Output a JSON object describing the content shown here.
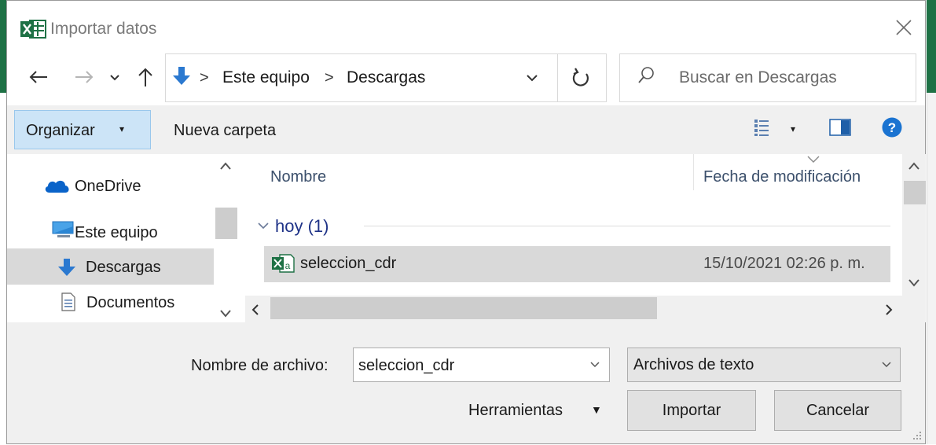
{
  "dialog": {
    "title": "Importar datos",
    "icons": {
      "app": "excel-icon",
      "close": "close-icon"
    }
  },
  "nav": {
    "address": {
      "crumbs": [
        "Este equipo",
        "Descargas"
      ],
      "separator": ">"
    },
    "search_placeholder": "Buscar en Descargas"
  },
  "toolbar": {
    "organize_label": "Organizar",
    "organize_caret": "▾",
    "new_folder_label": "Nueva carpeta",
    "view_caret": "▾"
  },
  "sidebar": {
    "items": [
      {
        "label": "OneDrive",
        "icon": "cloud-icon",
        "selected": false
      },
      {
        "label": "Este equipo",
        "icon": "computer-icon",
        "selected": false
      },
      {
        "label": "Descargas",
        "icon": "download-arrow-icon",
        "selected": true
      },
      {
        "label": "Documentos",
        "icon": "document-icon",
        "selected": false
      }
    ]
  },
  "files": {
    "columns": [
      "Nombre",
      "Fecha de modificación"
    ],
    "groups": [
      {
        "label": "hoy (1)",
        "items": [
          {
            "name": "seleccion_cdr",
            "modified": "15/10/2021 02:26 p. m.",
            "icon": "excel-csv-icon",
            "selected": true
          }
        ]
      }
    ]
  },
  "bottom": {
    "filename_label": "Nombre de archivo:",
    "filename_value": "seleccion_cdr",
    "filetype_value": "Archivos de texto",
    "tools_label": "Herramientas",
    "tools_caret": "▼",
    "import_label": "Importar",
    "cancel_label": "Cancelar"
  },
  "colors": {
    "excel_green": "#1e7145",
    "selection": "#d9d9d9",
    "accent_blue": "#1e6fb5",
    "organize_bg": "#cce4f7",
    "group_heading": "#1e3287"
  }
}
